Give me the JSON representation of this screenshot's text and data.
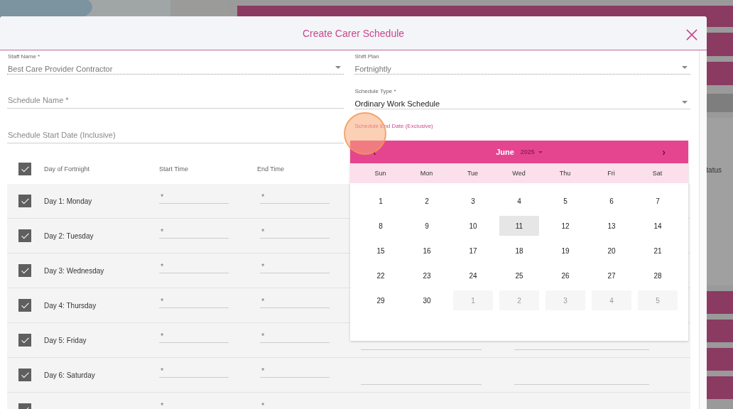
{
  "background": {
    "column_heading": "tatus"
  },
  "dialog": {
    "title": "Create Carer Schedule"
  },
  "fields": [
    {
      "kind": "select",
      "label": "Staff Name *",
      "value": "Best Care Provider Contractor",
      "disabled": true
    },
    {
      "kind": "text",
      "placeholder": "Schedule Name *"
    },
    {
      "kind": "text",
      "placeholder": "Schedule Start Date (Inclusive)"
    },
    {
      "kind": "select",
      "label": "Shift Plan",
      "value": "Fortnightly",
      "disabled": true
    },
    {
      "kind": "select",
      "label": "Schedule Type *",
      "value": "Ordinary Work Schedule",
      "disabled": false
    },
    {
      "kind": "date",
      "label": "Schedule End Date (Exclusive)",
      "focused": true
    }
  ],
  "table": {
    "all_checked": true,
    "columns": [
      "Day of Fortnight",
      "Start Time",
      "End Time"
    ],
    "rows": [
      {
        "day": "Day 1: Monday",
        "checked": true,
        "start_placeholder": "*",
        "end_placeholder": "*"
      },
      {
        "day": "Day 2: Tuesday",
        "checked": true,
        "start_placeholder": "*",
        "end_placeholder": "*"
      },
      {
        "day": "Day 3: Wednesday",
        "checked": true,
        "start_placeholder": "*",
        "end_placeholder": "*"
      },
      {
        "day": "Day 4: Thursday",
        "checked": true,
        "start_placeholder": "*",
        "end_placeholder": "*"
      },
      {
        "day": "Day 5: Friday",
        "checked": true,
        "start_placeholder": "*",
        "end_placeholder": "*"
      },
      {
        "day": "Day 6: Saturday",
        "checked": true,
        "start_placeholder": "*",
        "end_placeholder": "*"
      },
      {
        "checked": true,
        "start_placeholder": "*",
        "end_placeholder": "*"
      }
    ]
  },
  "calendar": {
    "prev": "‹",
    "next": "›",
    "month": "June",
    "year": "2025",
    "weekdays": [
      "Sun",
      "Mon",
      "Tue",
      "Wed",
      "Thu",
      "Fri",
      "Sat"
    ],
    "days": [
      {
        "label": "1",
        "kind": "current",
        "today": false
      },
      {
        "label": "2",
        "kind": "current",
        "today": false
      },
      {
        "label": "3",
        "kind": "current",
        "today": false
      },
      {
        "label": "4",
        "kind": "current",
        "today": false
      },
      {
        "label": "5",
        "kind": "current",
        "today": false
      },
      {
        "label": "6",
        "kind": "current",
        "today": false
      },
      {
        "label": "7",
        "kind": "current",
        "today": false
      },
      {
        "label": "8",
        "kind": "current",
        "today": false
      },
      {
        "label": "9",
        "kind": "current",
        "today": false
      },
      {
        "label": "10",
        "kind": "current",
        "today": false
      },
      {
        "label": "11",
        "kind": "current",
        "today": true
      },
      {
        "label": "12",
        "kind": "current",
        "today": false
      },
      {
        "label": "13",
        "kind": "current",
        "today": false
      },
      {
        "label": "14",
        "kind": "current",
        "today": false
      },
      {
        "label": "15",
        "kind": "current",
        "today": false
      },
      {
        "label": "16",
        "kind": "current",
        "today": false
      },
      {
        "label": "17",
        "kind": "current",
        "today": false
      },
      {
        "label": "18",
        "kind": "current",
        "today": false
      },
      {
        "label": "19",
        "kind": "current",
        "today": false
      },
      {
        "label": "20",
        "kind": "current",
        "today": false
      },
      {
        "label": "21",
        "kind": "current",
        "today": false
      },
      {
        "label": "22",
        "kind": "current",
        "today": false
      },
      {
        "label": "23",
        "kind": "current",
        "today": false
      },
      {
        "label": "24",
        "kind": "current",
        "today": false
      },
      {
        "label": "25",
        "kind": "current",
        "today": false
      },
      {
        "label": "26",
        "kind": "current",
        "today": false
      },
      {
        "label": "27",
        "kind": "current",
        "today": false
      },
      {
        "label": "28",
        "kind": "current",
        "today": false
      },
      {
        "label": "29",
        "kind": "current",
        "today": false
      },
      {
        "label": "30",
        "kind": "current",
        "today": false
      },
      {
        "label": "1",
        "kind": "other",
        "today": false
      },
      {
        "label": "2",
        "kind": "other",
        "today": false
      },
      {
        "label": "3",
        "kind": "other",
        "today": false
      },
      {
        "label": "4",
        "kind": "other",
        "today": false
      },
      {
        "label": "5",
        "kind": "other",
        "today": false
      }
    ]
  }
}
